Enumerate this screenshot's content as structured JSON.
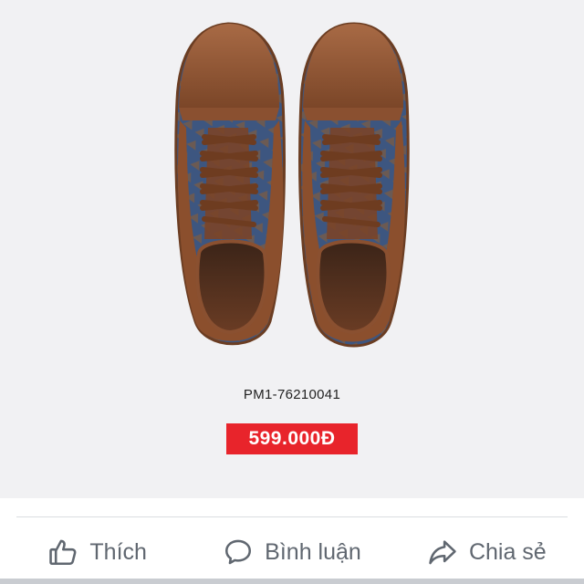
{
  "product": {
    "sku": "PM1-76210041",
    "price": "599.000Đ"
  },
  "actions": {
    "like_label": "Thích",
    "comment_label": "Bình luận",
    "share_label": "Chia sẻ"
  },
  "icons": {
    "like": "thumbs-up-icon",
    "comment": "speech-bubble-icon",
    "share": "share-arrow-icon"
  },
  "colors": {
    "price_background": "#e8242b",
    "price_text": "#ffffff",
    "action_text": "#606770"
  }
}
